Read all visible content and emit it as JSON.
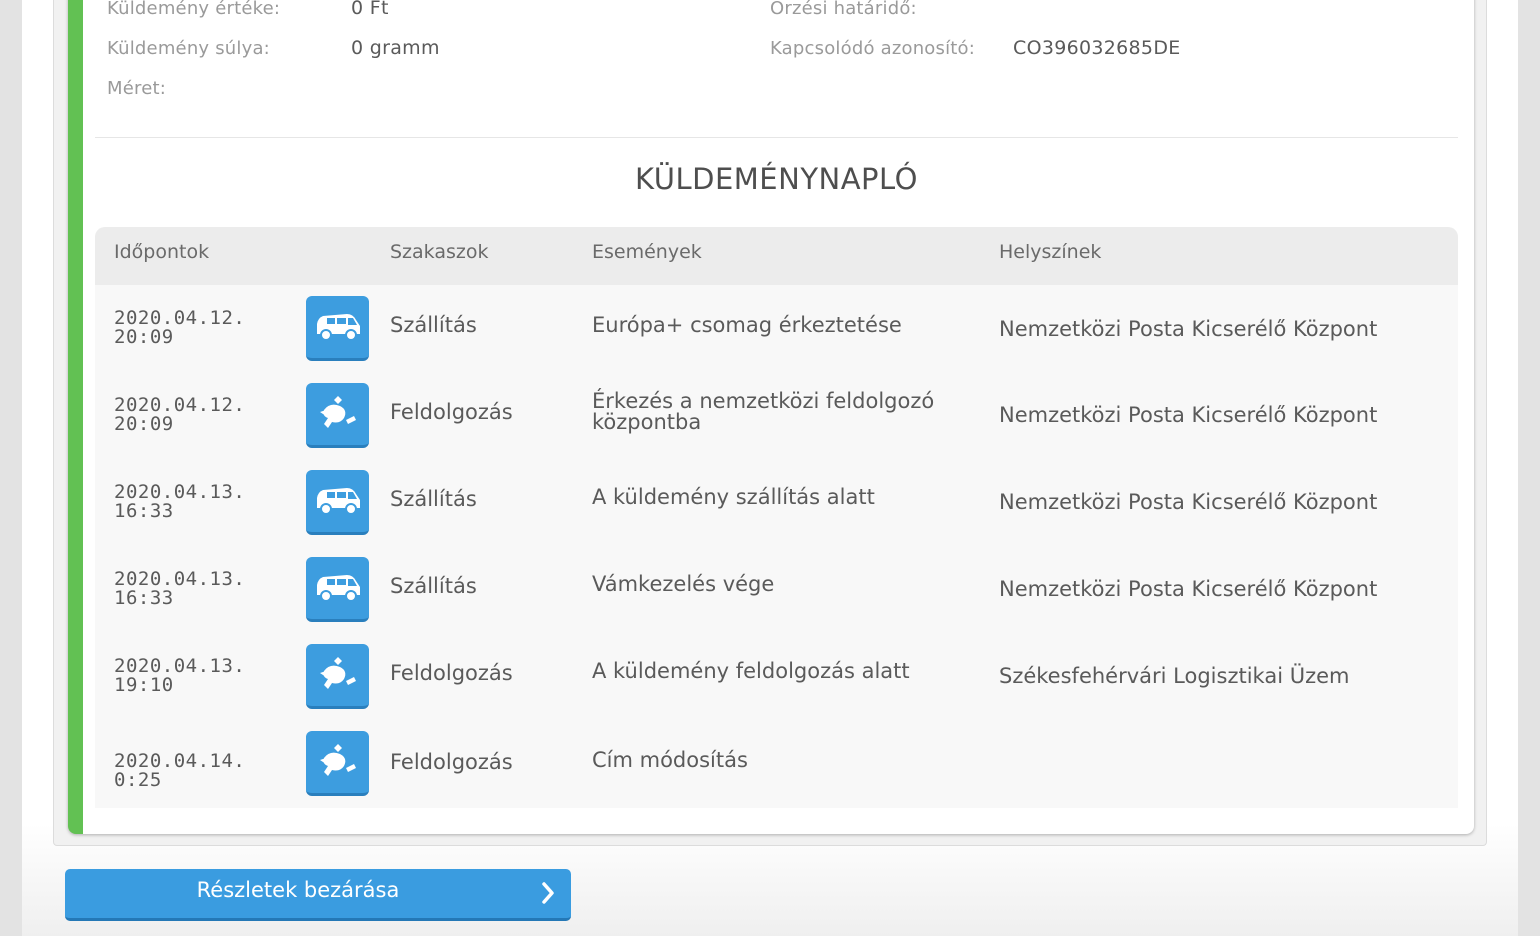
{
  "details": {
    "value_label": "Küldemény értéke:",
    "value": "0 Ft",
    "weight_label": "Küldemény súlya:",
    "weight": "0 gramm",
    "size_label": "Méret:",
    "size": "",
    "deadline_label": "Őrzési határidő:",
    "deadline": "",
    "related_id_label": "Kapcsolódó azonosító:",
    "related_id": "CO396032685DE"
  },
  "log": {
    "title": "KÜLDEMÉNYNAPLÓ",
    "headers": {
      "time": "Időpontok",
      "stage": "Szakaszok",
      "event": "Események",
      "location": "Helyszínek"
    },
    "rows": [
      {
        "date": "2020.04.12.",
        "time": "20:09",
        "icon": "van-icon",
        "stage": "Szállítás",
        "event": "Európa+ csomag érkeztetése",
        "location": "Nemzetközi Posta Kicserélő Központ"
      },
      {
        "date": "2020.04.12.",
        "time": "20:09",
        "icon": "processing-icon",
        "stage": "Feldolgozás",
        "event": "Érkezés a nemzetközi feldolgozó központba",
        "location": "Nemzetközi Posta Kicserélő Központ"
      },
      {
        "date": "2020.04.13.",
        "time": "16:33",
        "icon": "van-icon",
        "stage": "Szállítás",
        "event": "A küldemény szállítás alatt",
        "location": "Nemzetközi Posta Kicserélő Központ"
      },
      {
        "date": "2020.04.13.",
        "time": "16:33",
        "icon": "van-icon",
        "stage": "Szállítás",
        "event": "Vámkezelés vége",
        "location": "Nemzetközi Posta Kicserélő Központ"
      },
      {
        "date": "2020.04.13.",
        "time": "19:10",
        "icon": "processing-icon",
        "stage": "Feldolgozás",
        "event": "A küldemény feldolgozás alatt",
        "location": "Székesfehérvári Logisztikai Üzem"
      },
      {
        "date": "2020.04.14.",
        "time": "0:25",
        "icon": "processing-icon",
        "stage": "Feldolgozás",
        "event": "Cím módosítás",
        "location": ""
      }
    ]
  },
  "close_button": {
    "label": "Részletek bezárása",
    "icon": "chevron-right-icon"
  },
  "colors": {
    "accent_green": "#62c153",
    "icon_blue": "#3d9ddf",
    "button_blue": "#3a9ce0"
  }
}
